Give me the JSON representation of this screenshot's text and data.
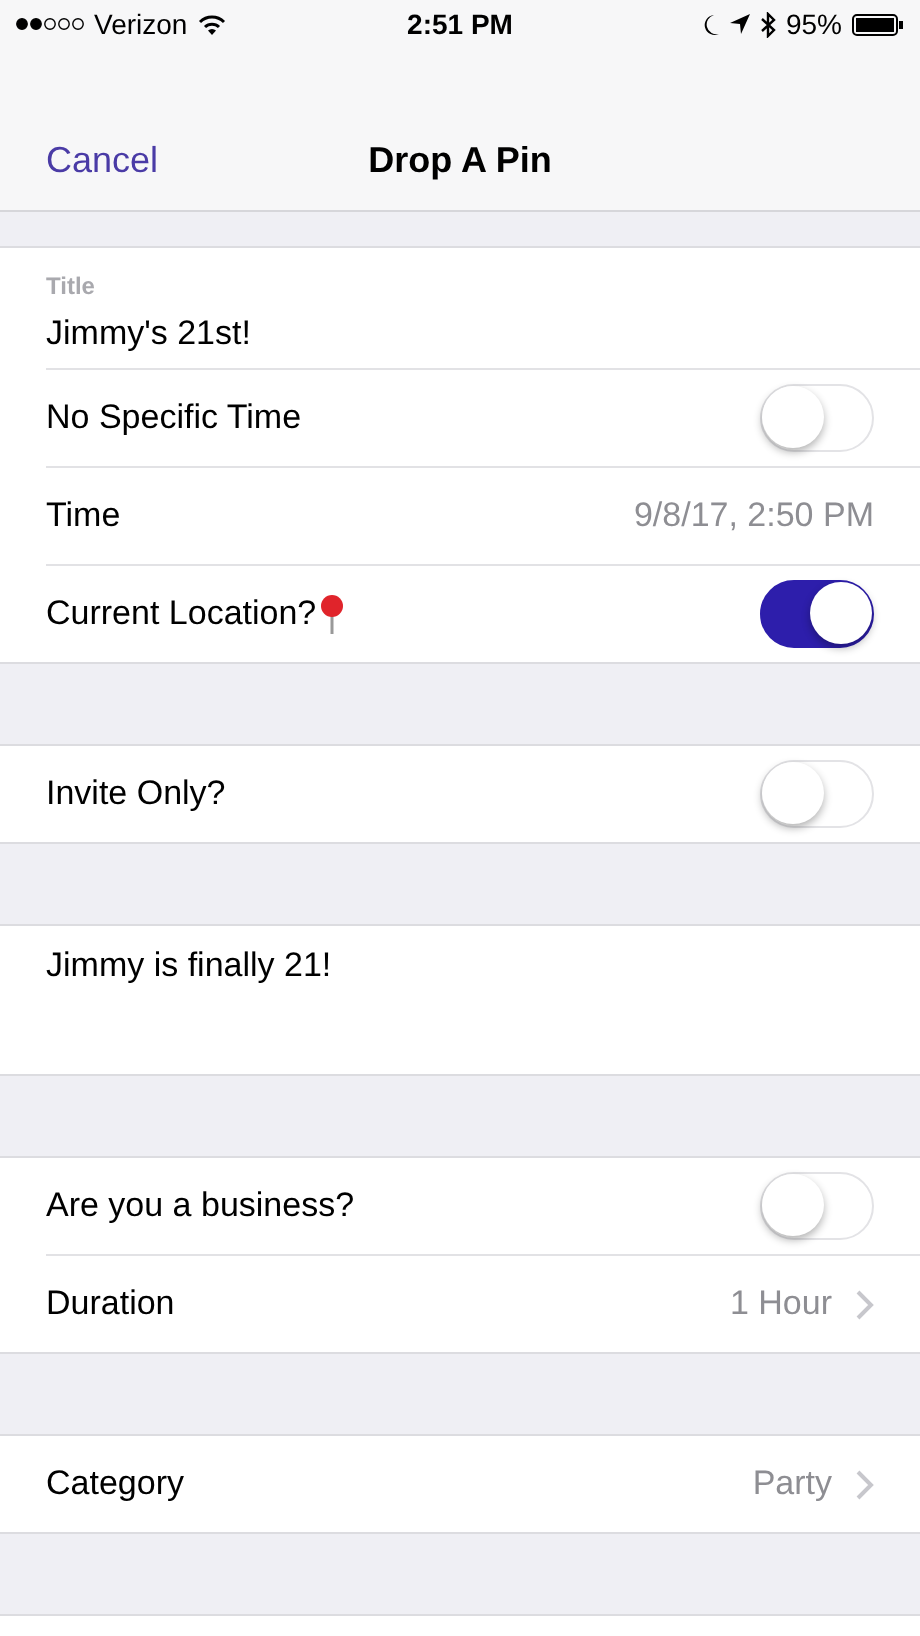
{
  "status_bar": {
    "carrier": "Verizon",
    "time": "2:51 PM",
    "battery": "95%"
  },
  "nav": {
    "left": "Cancel",
    "title": "Drop A Pin"
  },
  "sections": [
    {
      "rows": [
        {
          "kind": "field",
          "label": "Title",
          "value": "Jimmy's 21st!"
        },
        {
          "kind": "toggle",
          "label": "No Specific Time",
          "on": false
        },
        {
          "kind": "value",
          "label": "Time",
          "value": "9/8/17, 2:50 PM"
        },
        {
          "kind": "toggle",
          "label": "Current Location?",
          "pin": true,
          "on": true
        }
      ]
    },
    {
      "rows": [
        {
          "kind": "toggle",
          "label": "Invite Only?",
          "on": false
        }
      ]
    },
    {
      "rows": [
        {
          "kind": "note",
          "value": "Jimmy is finally 21!"
        }
      ]
    },
    {
      "rows": [
        {
          "kind": "toggle",
          "label": "Are you a business?",
          "on": false
        },
        {
          "kind": "disclosure",
          "label": "Duration",
          "value": "1 Hour"
        }
      ]
    },
    {
      "rows": [
        {
          "kind": "disclosure",
          "label": "Category",
          "value": "Party"
        }
      ]
    }
  ]
}
